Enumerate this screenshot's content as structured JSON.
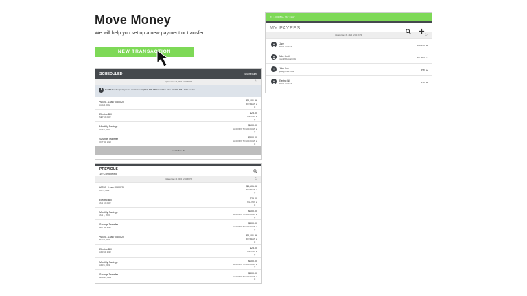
{
  "header": {
    "title": "Move Money",
    "subtitle": "We will help you set up a new payment or transfer",
    "new_transaction_label": "NEW TRANSACTION"
  },
  "scheduled": {
    "title": "SCHEDULED",
    "count": "4 Scheduled",
    "updated": "Updated Sep 30, 2024 12:02:39 PM",
    "info": "For Bill Pay Support, please contact us at (123) 456-7890 Available Mon-Fri 7:00 AM - 7:00 Am CT",
    "load_more": "Load More",
    "rows": [
      {
        "name": "*6789 - Loan *0500-20",
        "date": "AUG 4, 2022",
        "amount": "$3,101.96",
        "type": "PAYMENT"
      },
      {
        "name": "Electric Bill",
        "date": "SEP 10, 2022",
        "amount": "$25.00",
        "type": "BILL PAY"
      },
      {
        "name": "Monthly Savings",
        "date": "OCT 1, 2022",
        "amount": "$100.00",
        "type": "ACCOUNT TO ACCOUNT"
      },
      {
        "name": "Savings Transfer",
        "date": "OCT 31, 2022",
        "amount": "$300.00",
        "type": "ACCOUNT TO ACCOUNT"
      }
    ]
  },
  "previous": {
    "title": "PREVIOUS",
    "count": "10 Completed",
    "updated": "Updated Sep 30, 2024 12:02:39 PM",
    "rows": [
      {
        "name": "*6789 - Loan *0500-20",
        "date": "JUL 4, 2022",
        "amount": "$3,101.96",
        "type": "PAYMENT"
      },
      {
        "name": "Electric Bill",
        "date": "JUN 10, 2022",
        "amount": "$25.00",
        "type": "BILL PAY"
      },
      {
        "name": "Monthly Savings",
        "date": "JUN 1, 2022",
        "amount": "$100.00",
        "type": "ACCOUNT TO ACCOUNT"
      },
      {
        "name": "Savings Transfer",
        "date": "MAY 31, 2022",
        "amount": "$300.00",
        "type": "ACCOUNT TO ACCOUNT"
      },
      {
        "name": "*6789 - Loan *0500-20",
        "date": "MAY 4, 2022",
        "amount": "$3,101.96",
        "type": "PAYMENT"
      },
      {
        "name": "Electric Bill",
        "date": "APR 10, 2022",
        "amount": "$25.00",
        "type": "BILL PAY"
      },
      {
        "name": "Monthly Savings",
        "date": "APR 1, 2022",
        "amount": "$100.00",
        "type": "ACCOUNT TO ACCOUNT"
      },
      {
        "name": "Savings Transfer",
        "date": "MAR 31, 2022",
        "amount": "$300.00",
        "type": "ACCOUNT TO ACCOUNT"
      }
    ]
  },
  "payees": {
    "bar_label": "1,000 BILL PAY CHAT",
    "title": "MY PAYEES",
    "updated": "Updated Sep 30, 2024 12:02:39 PM",
    "items": [
      {
        "name": "Jane",
        "detail": "*1234 | CHECK",
        "badge": "BILL PAY"
      },
      {
        "name": "Mike Smith",
        "detail": "msmith@email.COM",
        "badge": "BILL PAY"
      },
      {
        "name": "John Doe",
        "detail": "jdoe@email.COM",
        "badge": "P2P"
      },
      {
        "name": "Electric Bill",
        "detail": "*1234 | CHECK",
        "badge": "P2P"
      }
    ]
  },
  "colors": {
    "accent": "#7ed957",
    "header_dark": "#45494d",
    "info_bg": "#dde3ea"
  }
}
